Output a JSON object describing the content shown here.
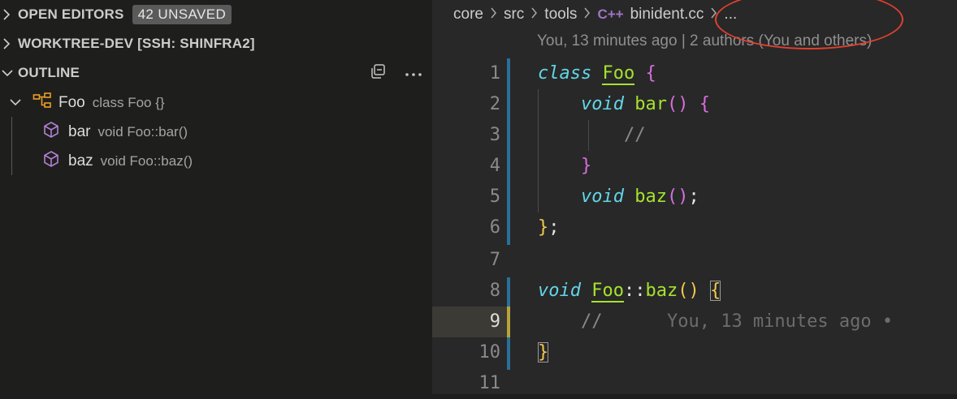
{
  "sidebar": {
    "open_editors": {
      "title": "OPEN EDITORS",
      "badge": "42 UNSAVED"
    },
    "worktree": {
      "title": "WORKTREE-DEV [SSH: SHINFRA2]"
    },
    "outline": {
      "title": "OUTLINE",
      "symbols": [
        {
          "name": "Foo",
          "detail": "class Foo {}"
        },
        {
          "name": "bar",
          "detail": "void Foo::bar()"
        },
        {
          "name": "baz",
          "detail": "void Foo::baz()"
        }
      ]
    }
  },
  "editor": {
    "breadcrumb": [
      "core",
      "src",
      "tools",
      "binident.cc",
      "..."
    ],
    "file_icon": "C++",
    "blame_header": "You, 13 minutes ago | 2 authors (You and others)",
    "line_numbers": [
      "1",
      "2",
      "3",
      "4",
      "5",
      "6",
      "7",
      "8",
      "9",
      "10",
      "11"
    ],
    "inline_blame": "You, 13 minutes ago •",
    "code": {
      "l1": [
        "class",
        "Foo",
        "{"
      ],
      "l2": [
        "void",
        "bar",
        "()",
        "{"
      ],
      "l3": [
        "//"
      ],
      "l4": [
        "}"
      ],
      "l5": [
        "void",
        "baz",
        "()",
        ";"
      ],
      "l6": [
        "}",
        ";"
      ],
      "l8": [
        "void",
        "Foo",
        "::",
        "baz",
        "()",
        "{"
      ],
      "l9": [
        "//"
      ],
      "l10": [
        "}"
      ]
    }
  },
  "colors": {
    "annotation": "#e2402e",
    "accent": "#62d6e8"
  }
}
